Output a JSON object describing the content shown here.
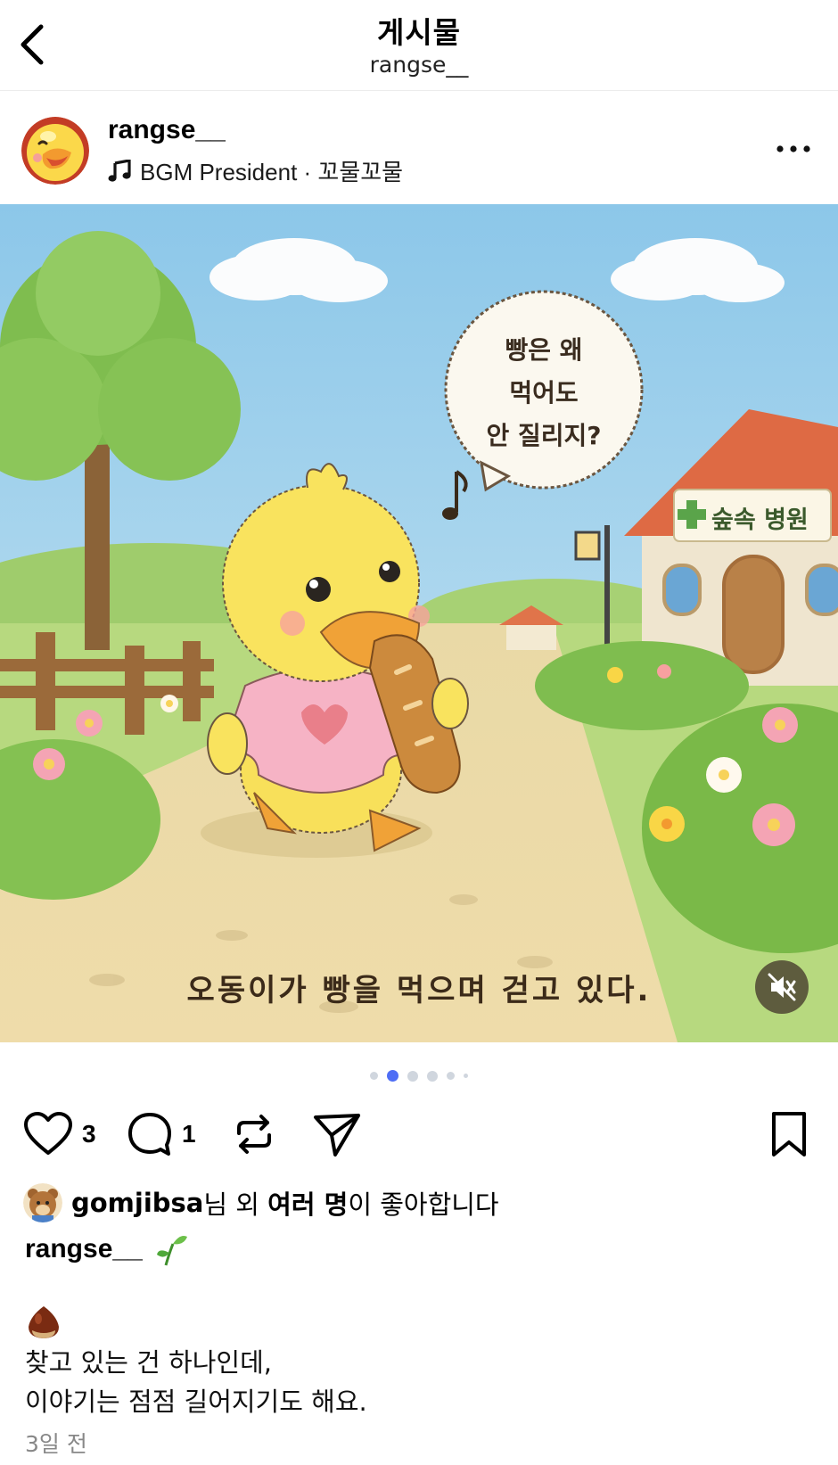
{
  "nav": {
    "title": "게시물",
    "subtitle": "rangse__"
  },
  "post": {
    "username": "rangse__",
    "music_label": "BGM President · 꼬물꼬물",
    "image": {
      "speech_bubble_lines": [
        "빵은 왜",
        "먹어도",
        "안 질리지?"
      ],
      "sign_text": "숲속 병원",
      "caption": "오동이가 빵을 먹으며 걷고 있다."
    },
    "carousel": {
      "total": 6,
      "active_index": 1
    },
    "like_count": "3",
    "comment_count": "1",
    "likes": {
      "user": "gomjibsa",
      "text_mid": "님 외 ",
      "others": "여러 명",
      "text_end": "이 좋아합니다"
    },
    "caption_user": "rangse__",
    "caption_lines": [
      "찾고 있는 건 하나인데,",
      "이야기는 점점 길어지기도 해요."
    ],
    "timestamp": "3일 전"
  },
  "icons": {
    "back": "chevron-left-icon",
    "more": "more-horizontal-icon",
    "music": "music-note-icon",
    "like": "heart-icon",
    "comment": "comment-icon",
    "repost": "repost-icon",
    "share": "send-icon",
    "save": "bookmark-icon",
    "mute": "speaker-muted-icon"
  },
  "colors": {
    "active_dot": "#4f6ef5",
    "inactive_dot": "#d0d6de",
    "timestamp": "#888888"
  }
}
